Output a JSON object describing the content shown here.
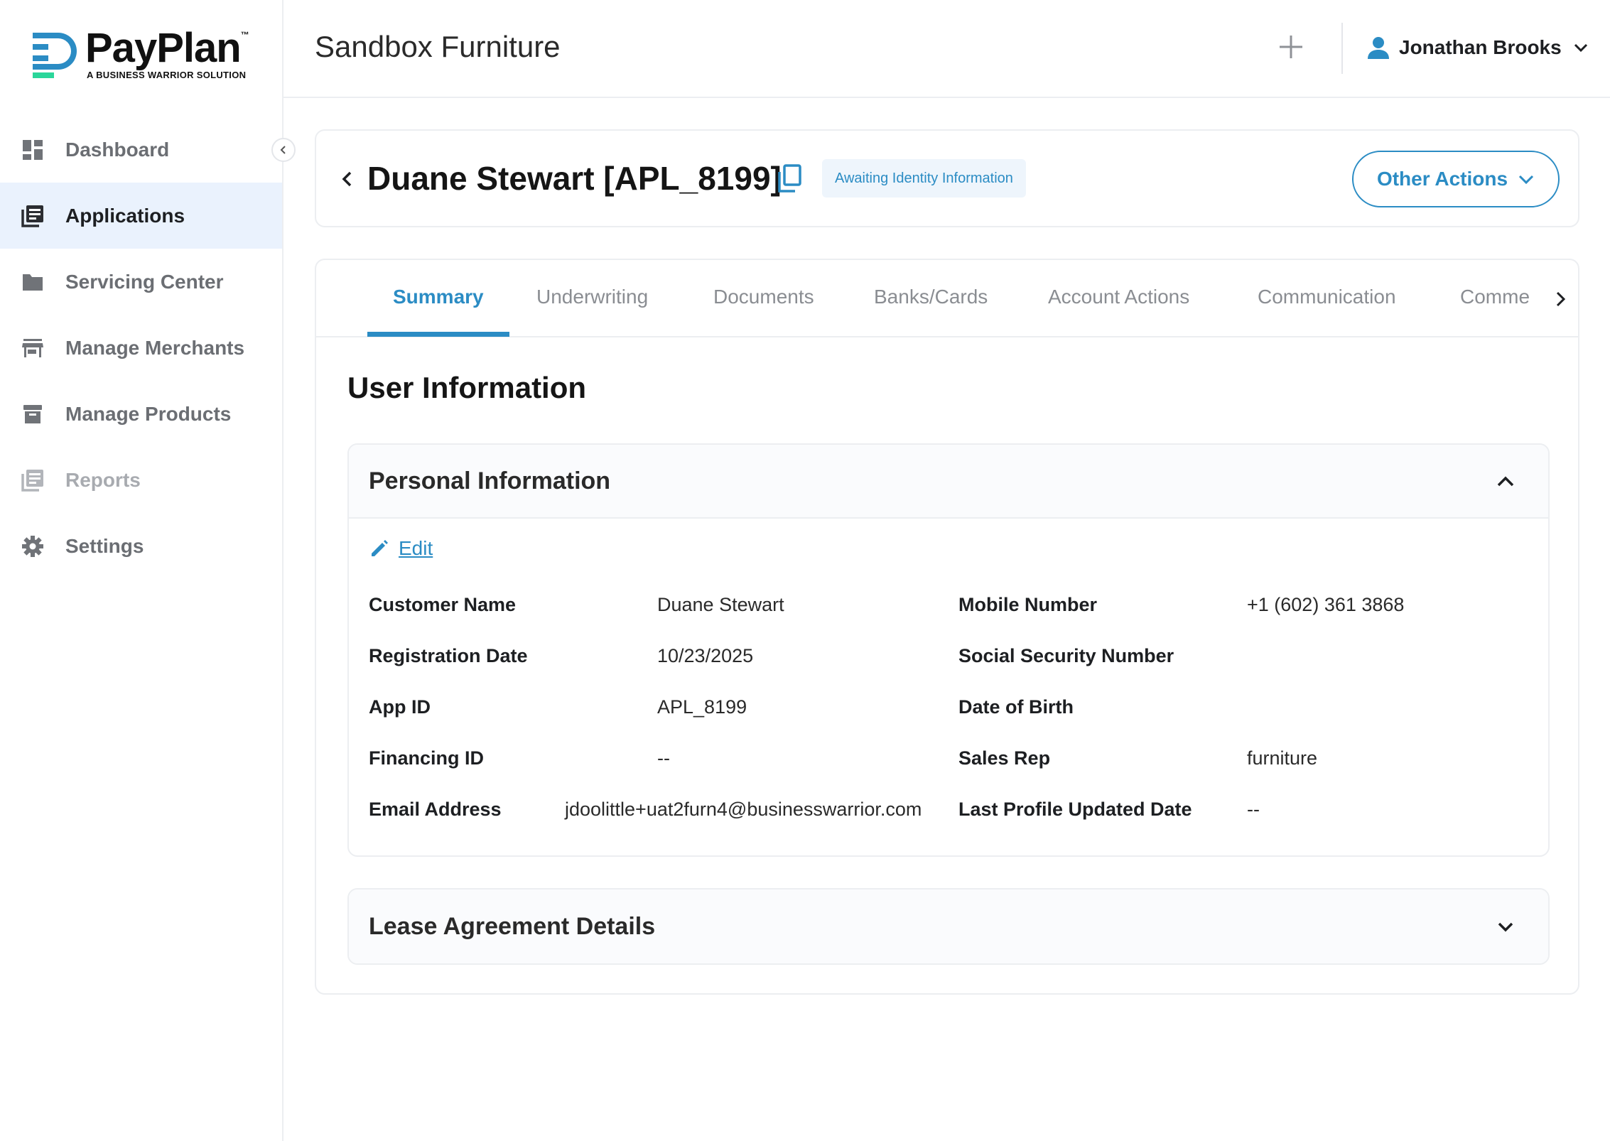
{
  "brand": {
    "name": "PayPlan",
    "tm": "™",
    "tagline": "A BUSINESS WARRIOR SOLUTION",
    "accent": "#2b8cc4",
    "logo_green": "#2bd69a"
  },
  "sidebar": {
    "items": [
      {
        "label": "Dashboard",
        "icon": "dashboard-icon"
      },
      {
        "label": "Applications",
        "icon": "applications-icon",
        "active": true
      },
      {
        "label": "Servicing Center",
        "icon": "folder-icon"
      },
      {
        "label": "Manage Merchants",
        "icon": "store-icon"
      },
      {
        "label": "Manage Products",
        "icon": "archive-icon"
      },
      {
        "label": "Reports",
        "icon": "reports-icon",
        "muted": true
      },
      {
        "label": "Settings",
        "icon": "gear-icon"
      }
    ]
  },
  "header": {
    "title": "Sandbox Furniture",
    "user_name": "Jonathan Brooks"
  },
  "application": {
    "title": "Duane Stewart [APL_8199]",
    "status": "Awaiting Identity Information",
    "other_actions_label": "Other Actions"
  },
  "tabs": [
    {
      "label": "Summary",
      "active": true
    },
    {
      "label": "Underwriting"
    },
    {
      "label": "Documents"
    },
    {
      "label": "Banks/Cards"
    },
    {
      "label": "Account Actions"
    },
    {
      "label": "Communication"
    },
    {
      "label": "Comme"
    }
  ],
  "summary": {
    "section_title": "User Information",
    "personal": {
      "title": "Personal Information",
      "edit_label": "Edit",
      "left_fields": [
        {
          "label": "Customer Name",
          "value": "Duane Stewart"
        },
        {
          "label": "Registration Date",
          "value": "10/23/2025"
        },
        {
          "label": "App ID",
          "value": "APL_8199"
        },
        {
          "label": "Financing ID",
          "value": "--"
        },
        {
          "label": "Email Address",
          "value": "jdoolittle+uat2furn4@businesswarrior.com"
        }
      ],
      "right_fields": [
        {
          "label": "Mobile Number",
          "value": "+1 (602) 361 3868"
        },
        {
          "label": "Social Security Number",
          "value": ""
        },
        {
          "label": "Date of Birth",
          "value": ""
        },
        {
          "label": "Sales Rep",
          "value": "furniture"
        },
        {
          "label": "Last Profile Updated Date",
          "value": "--"
        }
      ]
    },
    "lease": {
      "title": "Lease Agreement Details"
    }
  }
}
